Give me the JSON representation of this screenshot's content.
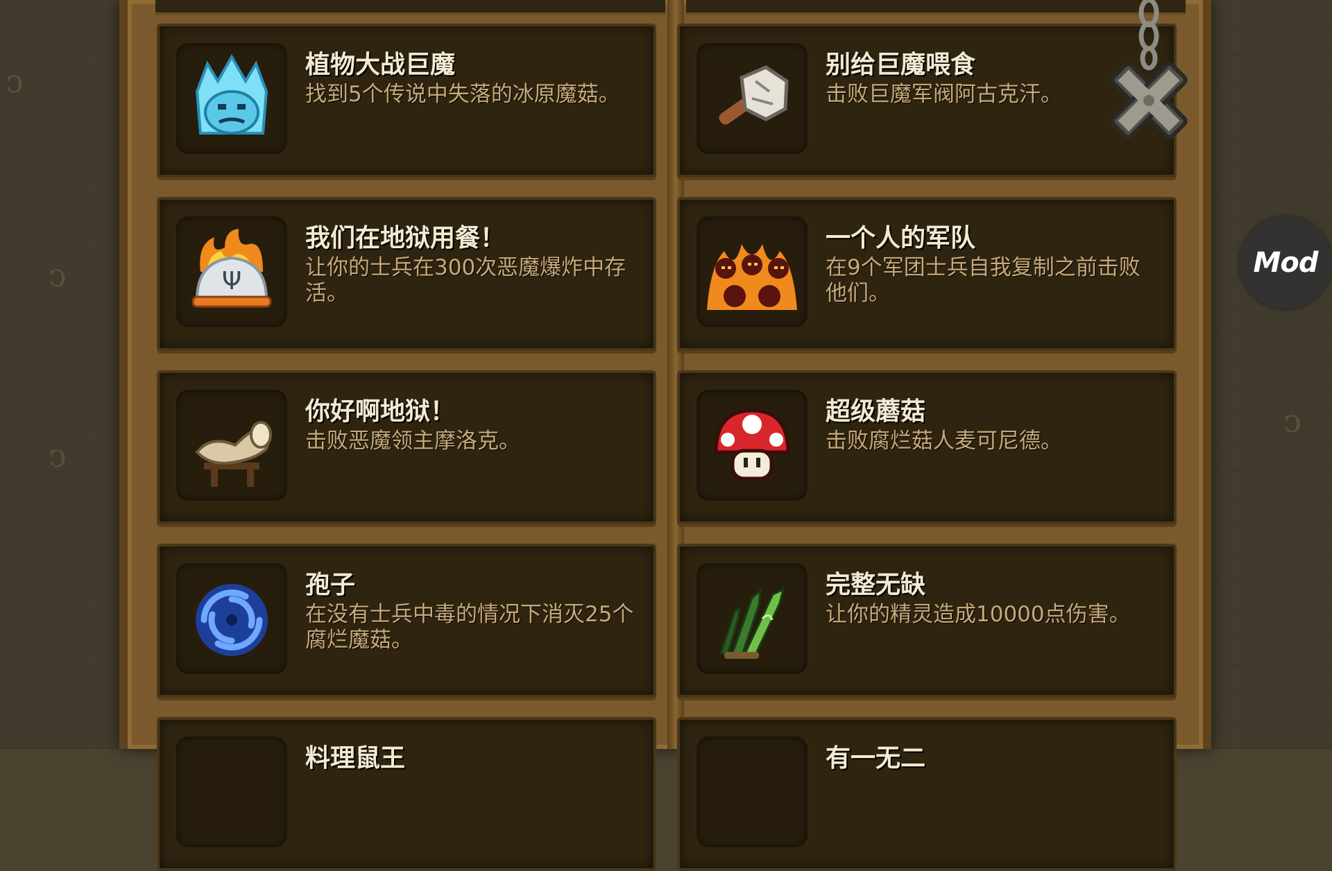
{
  "achievements": [
    {
      "title": "植物大战巨魔",
      "desc": "找到5个传说中失落的冰原魔菇。",
      "icon": "ice-golem-icon"
    },
    {
      "title": "别给巨魔喂食",
      "desc": "击败巨魔军阀阿古克汗。",
      "icon": "stone-club-icon"
    },
    {
      "title": "我们在地狱用餐！",
      "desc": "让你的士兵在300次恶魔爆炸中存活。",
      "icon": "flaming-cloche-icon"
    },
    {
      "title": "一个人的军队",
      "desc": "在9个军团士兵自我复制之前击败他们。",
      "icon": "demon-legion-icon"
    },
    {
      "title": "你好啊地狱！",
      "desc": "击败恶魔领主摩洛克。",
      "icon": "gramophone-horn-icon"
    },
    {
      "title": "超级蘑菇",
      "desc": "击败腐烂菇人麦可尼德。",
      "icon": "red-mushroom-icon"
    },
    {
      "title": "孢子",
      "desc": "在没有士兵中毒的情况下消灭25个腐烂魔菇。",
      "icon": "blue-spiral-icon"
    },
    {
      "title": "完整无缺",
      "desc": "让你的精灵造成10000点伤害。",
      "icon": "elven-blades-icon"
    },
    {
      "title": "料理鼠王",
      "desc": "",
      "icon": "partial-icon"
    },
    {
      "title": "有一无二",
      "desc": "",
      "icon": "partial-icon"
    }
  ],
  "close_icon": "close-x-icon",
  "mod_badge": "Mod",
  "colors": {
    "board": "#7a5a2c",
    "card": "#2e2410",
    "title": "#f3ead3",
    "desc": "#c8a97a",
    "background": "#4a4330"
  }
}
